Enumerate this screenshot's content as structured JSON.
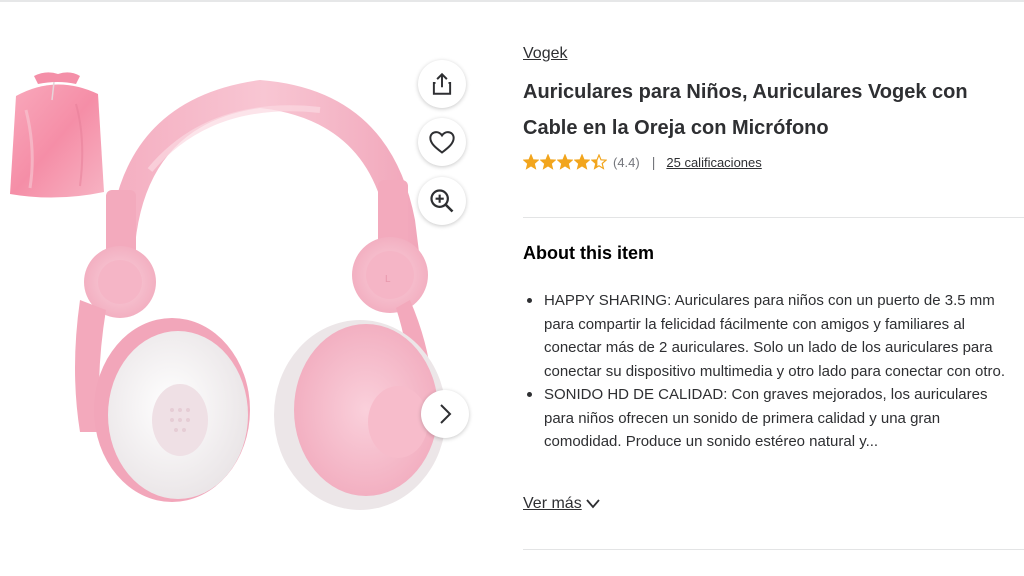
{
  "gallery": {
    "thumbnail_alt": "pink-drawstring-pouch",
    "image_alt": "pink-kids-headphones"
  },
  "actions": {
    "share_icon": "share-icon",
    "favorite_icon": "heart-icon",
    "zoom_icon": "zoom-in-icon",
    "next_icon": "chevron-right-icon"
  },
  "product": {
    "brand": "Vogek",
    "title": "Auriculares para Niños, Auriculares Vogek con Cable en la Oreja con Micrófono",
    "rating": 4.4,
    "rating_text": "(4.4)",
    "separator": "|",
    "ratings_count": "25 calificaciones"
  },
  "about": {
    "heading": "About this item",
    "bullets": [
      "HAPPY SHARING: Auriculares para niños con un puerto de 3.5 mm para compartir la felicidad fácilmente con amigos y familiares al conectar más de 2 auriculares. Solo un lado de los auriculares para conectar su dispositivo multimedia y otro lado para conectar con otro.",
      "SONIDO HD DE CALIDAD: Con graves mejorados, los auriculares para niños ofrecen un sonido de primera calidad y una gran comodidad. Produce un sonido estéreo natural y..."
    ],
    "see_more": "Ver más"
  },
  "colors": {
    "star": "#f2a51d",
    "text": "#2e2f32",
    "headphone_pink": "#f6b9c9",
    "cushion": "#f4f1f2"
  }
}
